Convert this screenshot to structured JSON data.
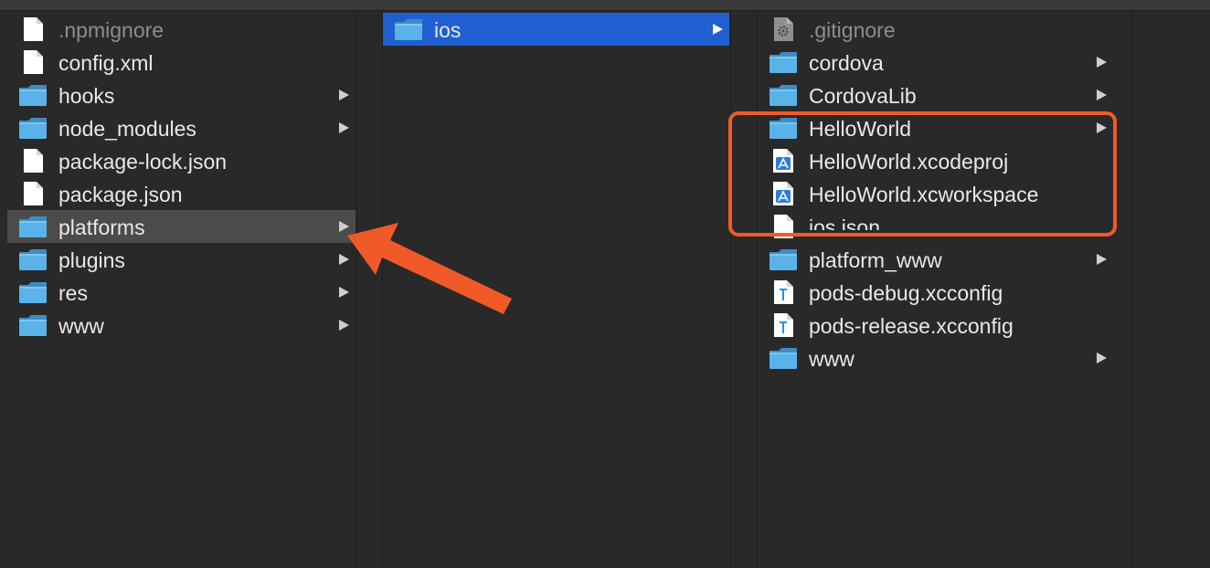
{
  "columns": [
    {
      "id": "col1",
      "items": [
        {
          "label": ".npmignore",
          "kind": "file",
          "dim": true,
          "folder": false,
          "state": ""
        },
        {
          "label": "config.xml",
          "kind": "file",
          "dim": false,
          "folder": false,
          "state": ""
        },
        {
          "label": "hooks",
          "kind": "folder",
          "dim": false,
          "folder": true,
          "state": ""
        },
        {
          "label": "node_modules",
          "kind": "folder",
          "dim": false,
          "folder": true,
          "state": ""
        },
        {
          "label": "package-lock.json",
          "kind": "file",
          "dim": false,
          "folder": false,
          "state": ""
        },
        {
          "label": "package.json",
          "kind": "file",
          "dim": false,
          "folder": false,
          "state": ""
        },
        {
          "label": "platforms",
          "kind": "folder",
          "dim": false,
          "folder": true,
          "state": "gray"
        },
        {
          "label": "plugins",
          "kind": "folder",
          "dim": false,
          "folder": true,
          "state": ""
        },
        {
          "label": "res",
          "kind": "folder",
          "dim": false,
          "folder": true,
          "state": ""
        },
        {
          "label": "www",
          "kind": "folder",
          "dim": false,
          "folder": true,
          "state": ""
        }
      ]
    },
    {
      "id": "col2",
      "items": [
        {
          "label": "ios",
          "kind": "folder",
          "dim": false,
          "folder": true,
          "state": "blue"
        }
      ]
    },
    {
      "id": "col3",
      "items": [
        {
          "label": ".gitignore",
          "kind": "gear-file",
          "dim": true,
          "folder": false,
          "state": ""
        },
        {
          "label": "cordova",
          "kind": "folder",
          "dim": false,
          "folder": true,
          "state": ""
        },
        {
          "label": "CordovaLib",
          "kind": "folder",
          "dim": false,
          "folder": true,
          "state": ""
        },
        {
          "label": "HelloWorld",
          "kind": "folder",
          "dim": false,
          "folder": true,
          "state": ""
        },
        {
          "label": "HelloWorld.xcodeproj",
          "kind": "xcode",
          "dim": false,
          "folder": false,
          "state": ""
        },
        {
          "label": "HelloWorld.xcworkspace",
          "kind": "xcode",
          "dim": false,
          "folder": false,
          "state": ""
        },
        {
          "label": "ios.json",
          "kind": "file",
          "dim": false,
          "folder": false,
          "state": "",
          "clipped": true
        },
        {
          "label": "platform_www",
          "kind": "folder",
          "dim": false,
          "folder": true,
          "state": ""
        },
        {
          "label": "pods-debug.xcconfig",
          "kind": "xcconfig",
          "dim": false,
          "folder": false,
          "state": ""
        },
        {
          "label": "pods-release.xcconfig",
          "kind": "xcconfig",
          "dim": false,
          "folder": false,
          "state": ""
        },
        {
          "label": "www",
          "kind": "folder",
          "dim": false,
          "folder": true,
          "state": ""
        }
      ]
    }
  ],
  "colors": {
    "background": "#292929",
    "selected_gray": "#4b4b4b",
    "selected_blue": "#1f5fcf",
    "folder_blue": "#5ab3e8",
    "annotation": "#f05a28"
  },
  "annotation": {
    "arrow": "arrow pointing to platforms",
    "box": "highlight box around HelloWorld items"
  }
}
